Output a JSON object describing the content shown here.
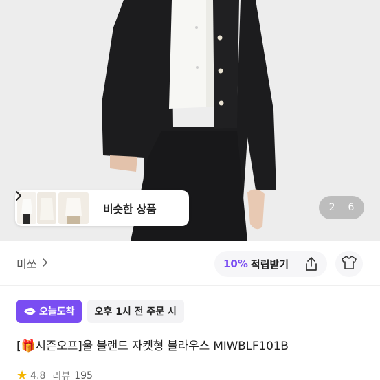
{
  "gallery": {
    "similar_label": "비슷한 상품",
    "pager_current": "2",
    "pager_total": "6"
  },
  "brand": {
    "name": "미쏘"
  },
  "reward": {
    "percent": "10%",
    "label": "적립받기"
  },
  "delivery": {
    "badge": "오늘도착",
    "cutoff": "오후 1시 전 주문 시"
  },
  "product": {
    "title_prefix": "[",
    "title_gift_icon": "🎁",
    "title_rest": "시즌오프]울 블랜드 자켓형 블라우스 MIWBLF101B"
  },
  "rating": {
    "score": "4.8",
    "review_label": "리뷰",
    "review_count": "195"
  },
  "colors": {
    "accent": "#7a4df2"
  },
  "icons": [
    "chevron-right-icon",
    "share-icon",
    "closet-icon",
    "star-icon",
    "delivery-arrow-icon",
    "gift-icon"
  ]
}
